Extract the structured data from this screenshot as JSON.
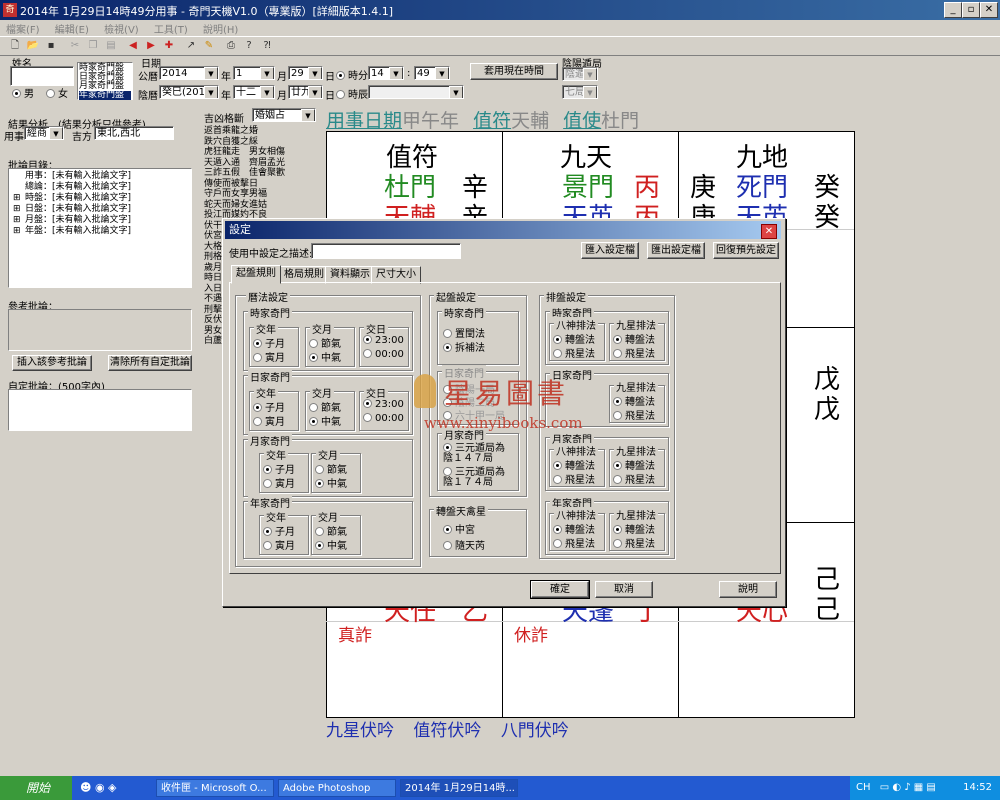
{
  "window": {
    "title": "2014年 1月29日14時49分用事 - 奇門天機V1.0（專業版）[詳細版本1.4.1]"
  },
  "menu": [
    "檔案(F)",
    "編輯(E)",
    "檢視(V)",
    "工具(T)",
    "說明(H)"
  ],
  "top": {
    "name_label": "姓名",
    "gender_male": "男",
    "gender_female": "女",
    "chart_types": [
      "時家奇門盤",
      "日家奇門盤",
      "月家奇門盤",
      "年家奇門盤"
    ],
    "date_label": "日期",
    "solar_label": "公曆",
    "year": "2014",
    "year_u": "年",
    "month": "1",
    "month_u": "月",
    "day": "29",
    "day_u": "日",
    "hour_minute_label": "時分",
    "hour": "14",
    "minute": "49",
    "lunar_label": "陰曆",
    "lunar_year": "癸巳(2013",
    "lunar_month": "十二",
    "lunar_day": "廿九",
    "hour_branch_label": "時辰",
    "now_button": "套用現在時間",
    "yinyang_label": "陰陽遁局",
    "dun": "陰遁",
    "ju": "七局"
  },
  "left": {
    "result_label": "結果分析　(結果分析只供參考)",
    "yongshi_label": "用事",
    "yongshi": "經商",
    "direction_label": "吉方",
    "direction": "東北,西北",
    "comments_label": "批論目錄：",
    "tree": [
      "用事：[未有輸入批論文字]",
      "總論：[未有輸入批論文字]",
      "時盤：[未有輸入批論文字]",
      "日盤：[未有輸入批論文字]",
      "月盤：[未有輸入批論文字]",
      "年盤：[未有輸入批論文字]"
    ],
    "ref_label": "參考批論：",
    "insert_btn": "插入該參考批論",
    "clear_btn": "清除所有自定批論",
    "custom_label": "自定批論：(500字內)"
  },
  "mid": {
    "label": "吉凶格斷",
    "select": "婚姻占",
    "list": "返首乘龍之婚\n跌穴自獲之綵\n虎狂龍走　男女相傷\n天遁入通　齊眉孟光\n三詐五假　佳會聚歡\n傳使而被擊日\n守戶而女享男福\n蛇天而婦女進姑\n投江而媒妁不良\n伏干乘旺之應明相\n伏宮\n大格\n刑格\n歲月\n時日\n入日\n不遇\n刑擊\n反伏\n男女\n白蘆"
  },
  "board": {
    "header_parts": [
      "用事日期",
      "甲午年",
      "值符",
      "天輔",
      "值使",
      "杜門"
    ],
    "cells": [
      {
        "top": "值符",
        "mid_l": "杜門",
        "mid_r": "辛",
        "bot_l": "天輔",
        "bot_r": "辛"
      },
      {
        "top": "九天",
        "mid_l": "景門",
        "mid_r": "丙",
        "bot_l": "天英",
        "bot_r": "丙"
      },
      {
        "top": "九地",
        "mid_ll": "庚",
        "mid_l": "死門",
        "mid_r": "癸",
        "bot_ll": "庚",
        "bot_l": "天芮",
        "bot_r": "癸"
      }
    ],
    "mid_right": [
      "戊",
      "戊"
    ],
    "bottom_cells": [
      {
        "chars_l": "天任",
        "chars_r": "乙",
        "tag": "真詐"
      },
      {
        "chars_l": "天蓬",
        "chars_r": "丁",
        "tag": "休詐"
      },
      {
        "chars_l": "天心",
        "chars_r": "己",
        "extra": "己"
      }
    ],
    "footer": [
      "九星伏吟",
      "值符伏吟",
      "八門伏吟"
    ]
  },
  "dialog": {
    "title": "設定",
    "desc_label": "使用中設定之描述:",
    "import_btn": "匯入設定檔",
    "export_btn": "匯出設定檔",
    "reset_btn": "回復預先設定",
    "tabs": [
      "起盤規則",
      "格局規則",
      "資料顯示",
      "尺寸大小"
    ],
    "calendar_group": "曆法設定",
    "sections": [
      {
        "title": "時家奇門",
        "a": "交年",
        "b": "交月",
        "c": "交日"
      },
      {
        "title": "日家奇門",
        "a": "交年",
        "b": "交月",
        "c": "交日"
      },
      {
        "title": "月家奇門",
        "a": "交年",
        "b": "交月"
      },
      {
        "title": "年家奇門",
        "a": "交年",
        "b": "交月"
      }
    ],
    "zi": "子月",
    "yin": "寅月",
    "jie": "節氣",
    "zhong": "中氣",
    "t23": "23:00",
    "t00": "00:00",
    "qipan_group": "起盤設定",
    "q_shi": "時家奇門",
    "q_shi_a": "置閏法",
    "q_shi_b": "拆補法",
    "q_ri": "日家奇門",
    "q_ri_a": "陰陽一局",
    "q_ri_b": "陰陽二局",
    "q_ri_c": "六十甲一局",
    "q_yue": "月家奇門",
    "q_yue_a": "三元遁局為陰１４７局",
    "q_yue_b": "三元遁局為陰１７４局",
    "zhuan_group": "轉盤天禽星",
    "zhuan_a": "中宮",
    "zhuan_b": "隨天芮",
    "paipan_group": "排盤設定",
    "p_sections": [
      "時家奇門",
      "日家奇門",
      "月家奇門",
      "年家奇門"
    ],
    "p_a": "八神排法",
    "p_b": "九星排法",
    "p_turn": "轉盤法",
    "p_fly": "飛星法",
    "ok": "確定",
    "cancel": "取消",
    "help": "說明"
  },
  "watermark": {
    "text": "星易圖書",
    "url": "www.xinyibooks.com"
  },
  "taskbar": {
    "start": "開始",
    "tasks": [
      "收件匣 - Microsoft O...",
      "Adobe Photoshop",
      "2014年 1月29日14時..."
    ],
    "lang": "CH",
    "clock": "14:52"
  },
  "colors": {
    "green": "#228b22",
    "red": "#d02020",
    "blue": "#1e2fb0",
    "teal": "#2a8a8a"
  }
}
